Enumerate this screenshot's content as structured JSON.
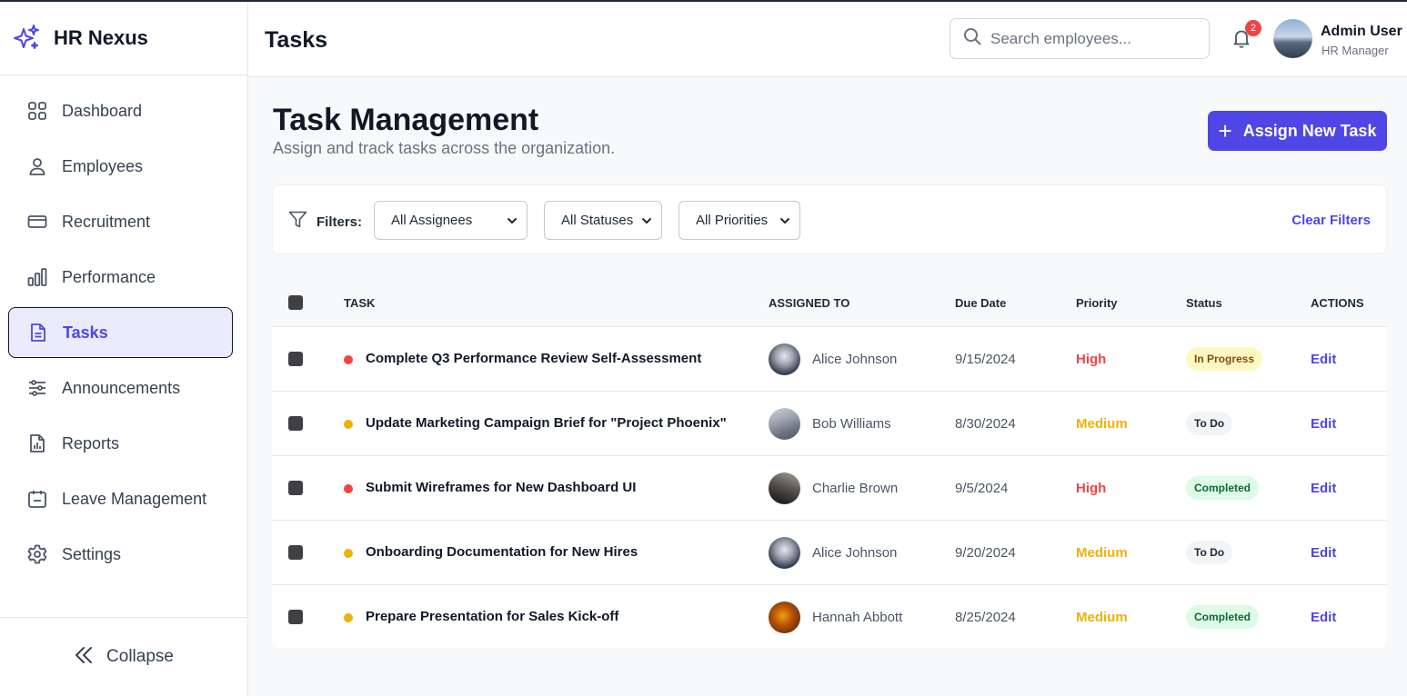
{
  "app": {
    "name": "HR Nexus"
  },
  "sidebar": {
    "items": [
      {
        "label": "Dashboard",
        "icon": "grid-icon"
      },
      {
        "label": "Employees",
        "icon": "user-icon"
      },
      {
        "label": "Recruitment",
        "icon": "card-icon"
      },
      {
        "label": "Performance",
        "icon": "bar-chart-icon"
      },
      {
        "label": "Tasks",
        "icon": "document-icon",
        "active": true
      },
      {
        "label": "Announcements",
        "icon": "sliders-icon"
      },
      {
        "label": "Reports",
        "icon": "report-icon"
      },
      {
        "label": "Leave Management",
        "icon": "calendar-icon"
      },
      {
        "label": "Settings",
        "icon": "gear-icon"
      }
    ],
    "collapse_label": "Collapse"
  },
  "header": {
    "title": "Tasks",
    "search_placeholder": "Search employees...",
    "notification_count": "2",
    "user_name": "Admin User",
    "user_role": "HR Manager"
  },
  "main": {
    "title": "Task Management",
    "subtitle": "Assign and track tasks across the organization.",
    "assign_button": "Assign New Task"
  },
  "filters": {
    "label": "Filters:",
    "assignee": "All Assignees",
    "status": "All Statuses",
    "priority": "All Priorities",
    "clear": "Clear Filters"
  },
  "table": {
    "columns": [
      "TASK",
      "ASSIGNED TO",
      "Due Date",
      "Priority",
      "Status",
      "ACTIONS"
    ],
    "rows": [
      {
        "title": "Complete Q3 Performance Review Self-Assessment",
        "assignee": "Alice Johnson",
        "due": "9/15/2024",
        "priority": "High",
        "status": "In Progress",
        "action": "Edit"
      },
      {
        "title": "Update Marketing Campaign Brief for \"Project Phoenix\"",
        "assignee": "Bob Williams",
        "due": "8/30/2024",
        "priority": "Medium",
        "status": "To Do",
        "action": "Edit"
      },
      {
        "title": "Submit Wireframes for New Dashboard UI",
        "assignee": "Charlie Brown",
        "due": "9/5/2024",
        "priority": "High",
        "status": "Completed",
        "action": "Edit"
      },
      {
        "title": "Onboarding Documentation for New Hires",
        "assignee": "Alice Johnson",
        "due": "9/20/2024",
        "priority": "Medium",
        "status": "To Do",
        "action": "Edit"
      },
      {
        "title": "Prepare Presentation for Sales Kick-off",
        "assignee": "Hannah Abbott",
        "due": "8/25/2024",
        "priority": "Medium",
        "status": "Completed",
        "action": "Edit"
      }
    ]
  },
  "colors": {
    "accent": "#4f46e5",
    "high": "#ef4444",
    "medium": "#eab308",
    "in_progress_bg": "#fef9c3",
    "in_progress_fg": "#854d0e",
    "todo_bg": "#f3f4f6",
    "todo_fg": "#1f2937",
    "completed_bg": "#dcfce7",
    "completed_fg": "#166534"
  }
}
